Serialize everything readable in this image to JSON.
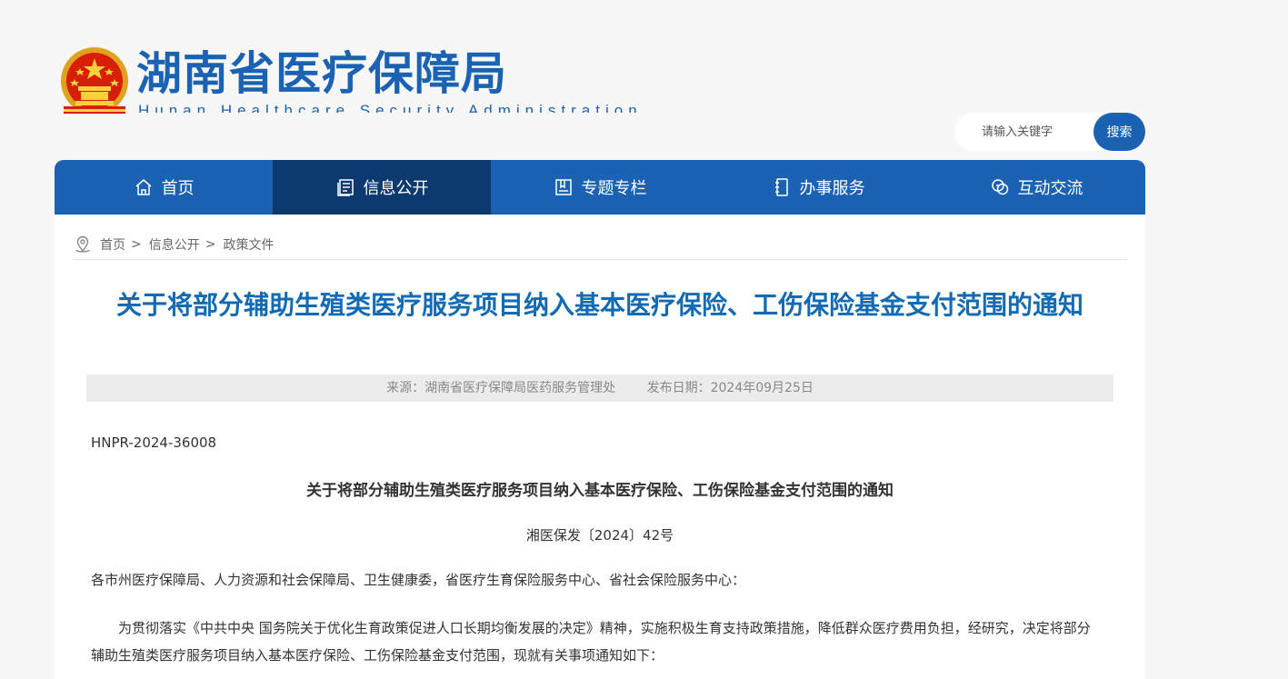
{
  "header": {
    "site_title": "湖南省医疗保障局",
    "site_subtitle": "Hunan Healthcare Security Administration",
    "emblem_icon": "national-emblem-icon",
    "brand_color": "#1b63b2"
  },
  "search": {
    "placeholder": "请输入关键字",
    "button_label": "搜索"
  },
  "nav": {
    "items": [
      {
        "label": "首页",
        "icon": "home-icon"
      },
      {
        "label": "信息公开",
        "icon": "document-list-icon"
      },
      {
        "label": "专题专栏",
        "icon": "book-icon"
      },
      {
        "label": "办事服务",
        "icon": "notebook-icon"
      },
      {
        "label": "互动交流",
        "icon": "chat-bubbles-icon"
      }
    ],
    "active_index": 1,
    "active_color": "#0d3a6e"
  },
  "breadcrumb": {
    "icon": "location-pin-icon",
    "items": [
      "首页",
      "信息公开",
      "政策文件"
    ],
    "separator": ">"
  },
  "article": {
    "title": "关于将部分辅助生殖类医疗服务项目纳入基本医疗保险、工伤保险基金支付范围的通知",
    "source": "来源：湖南省医疗保障局医药服务管理处",
    "publish_date": "发布日期：2024年09月25日",
    "doc_code": "HNPR-2024-36008",
    "doc_title": "关于将部分辅助生殖类医疗服务项目纳入基本医疗保险、工伤保险基金支付范围的通知",
    "doc_number": "湘医保发〔2024〕42号",
    "addressee": "各市州医疗保障局、人力资源和社会保障局、卫生健康委，省医疗生育保险服务中心、省社会保险服务中心：",
    "paragraph1": "为贯彻落实《中共中央 国务院关于优化生育政策促进人口长期均衡发展的决定》精神，实施积极生育支持政策措施，降低群众医疗费用负担，经研究，决定将部分辅助生殖类医疗服务项目纳入基本医疗保险、工伤保险基金支付范围，现就有关事项通知如下："
  }
}
